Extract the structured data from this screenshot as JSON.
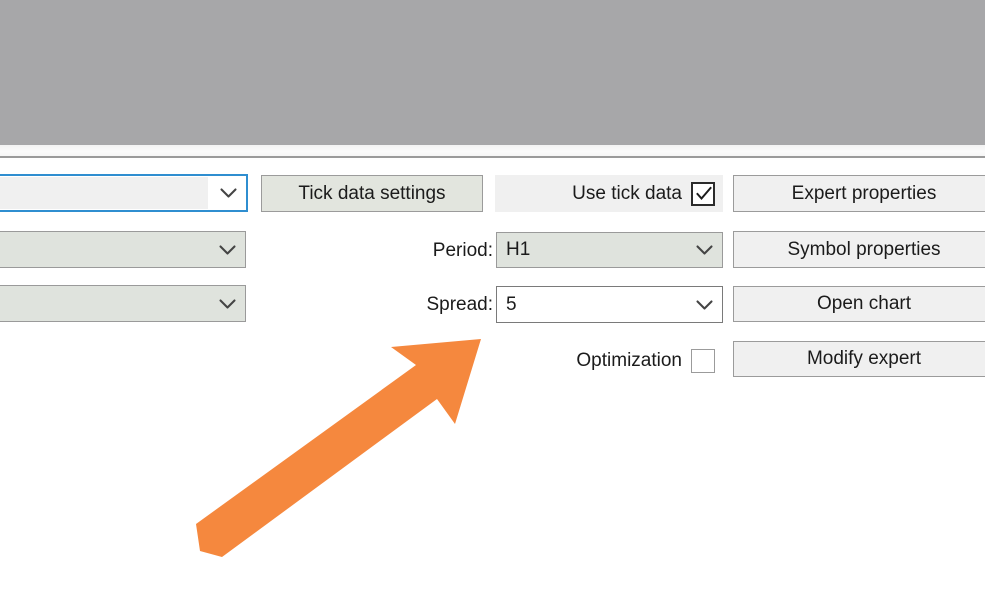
{
  "window": {
    "top_region": "blurred-toolbar-area",
    "background_color": "#a7a7a9"
  },
  "colors": {
    "accent_focus": "#2f8ed0",
    "annotation_arrow": "#f5883e",
    "control_green_fill": "#dfe3dd",
    "button_fill": "#f0f0f0",
    "border": "#9b9b9b",
    "text": "#1b1b1b"
  },
  "left_column": {
    "combos": [
      {
        "name": "symbol-combo",
        "value": "",
        "placeholder": "",
        "focused": true
      },
      {
        "name": "model-combo",
        "value": "",
        "placeholder": "",
        "focused": false
      },
      {
        "name": "date-combo",
        "value": "",
        "placeholder": "",
        "focused": false
      }
    ]
  },
  "middle_column": {
    "tick_data_settings_label": "Tick data settings",
    "period_label": "Period:",
    "period_value": "H1",
    "spread_label": "Spread:",
    "spread_value": "5",
    "use_tick_data_label": "Use tick data",
    "use_tick_data_checked": true,
    "optimization_label": "Optimization",
    "optimization_checked": false
  },
  "right_column": {
    "buttons": [
      {
        "label": "Expert properties"
      },
      {
        "label": "Symbol properties"
      },
      {
        "label": "Open chart"
      },
      {
        "label": "Modify expert"
      }
    ]
  },
  "annotation": {
    "type": "arrow",
    "color": "#f5883e",
    "points_to": "Spread:",
    "direction": "up-right"
  },
  "icons": {
    "chevron_down": "chevron-down-icon",
    "checkmark": "checkmark-icon"
  }
}
